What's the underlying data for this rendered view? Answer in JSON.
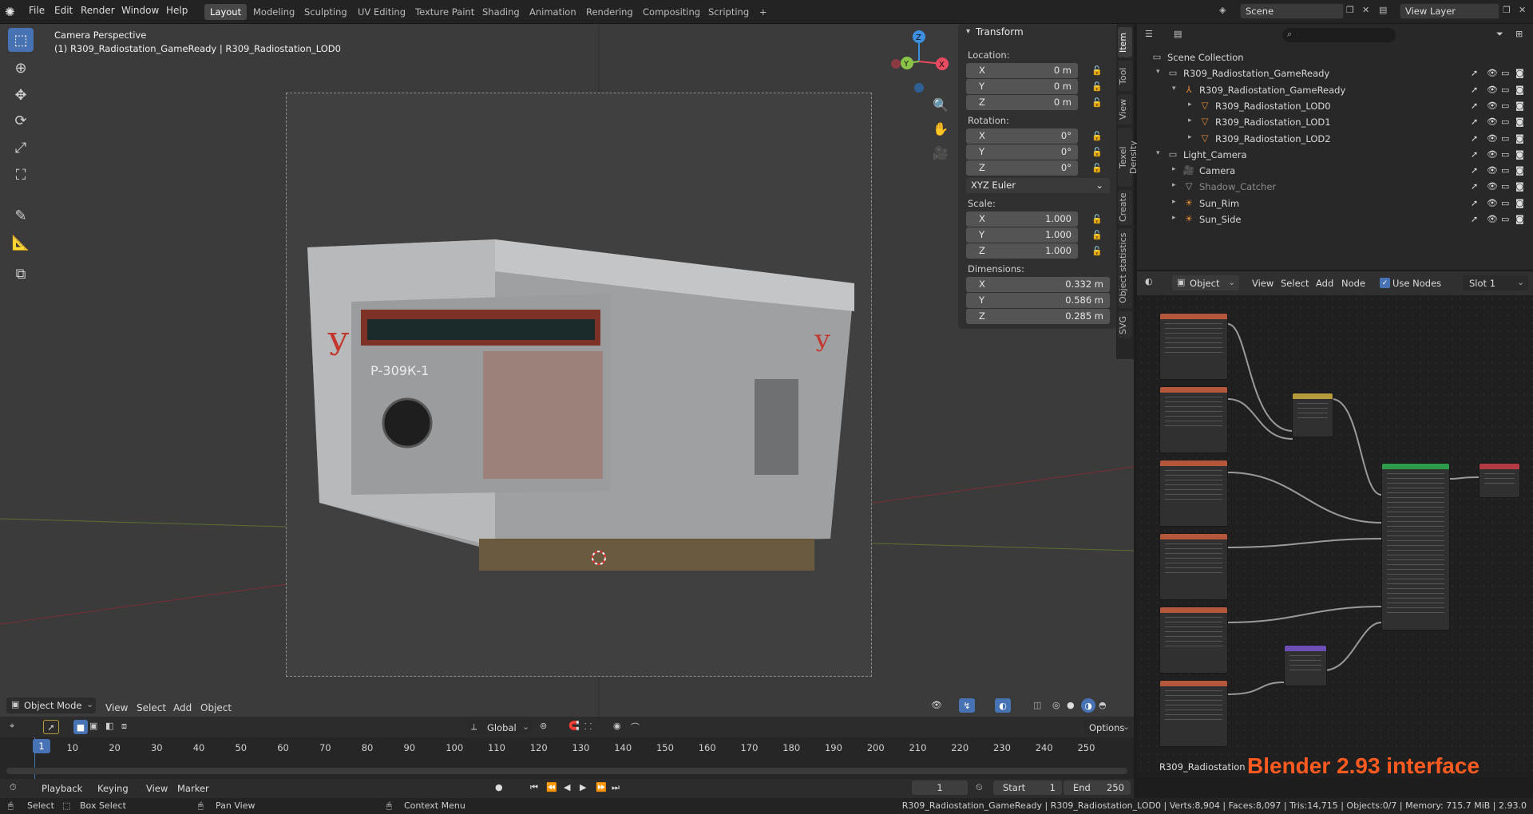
{
  "menu": {
    "items": [
      "File",
      "Edit",
      "Render",
      "Window",
      "Help"
    ]
  },
  "workspaces": {
    "tabs": [
      "Layout",
      "Modeling",
      "Sculpting",
      "UV Editing",
      "Texture Paint",
      "Shading",
      "Animation",
      "Rendering",
      "Compositing",
      "Scripting"
    ],
    "add": "+"
  },
  "scene": {
    "label": "Scene",
    "view_layer": "View Layer"
  },
  "viewport": {
    "title": "Camera Perspective",
    "subtitle": "(1) R309_Radiostation_GameReady | R309_Radiostation_LOD0",
    "mode": "Object Mode",
    "menu": [
      "View",
      "Select",
      "Add",
      "Object"
    ],
    "transform_orientation": "Global",
    "options": "Options",
    "gizmo": {
      "x": "X",
      "y": "Y",
      "z": "Z"
    }
  },
  "npanel": {
    "header": "Transform",
    "location_label": "Location:",
    "location": [
      {
        "axis": "X",
        "value": "0 m"
      },
      {
        "axis": "Y",
        "value": "0 m"
      },
      {
        "axis": "Z",
        "value": "0 m"
      }
    ],
    "rotation_label": "Rotation:",
    "rotation": [
      {
        "axis": "X",
        "value": "0°"
      },
      {
        "axis": "Y",
        "value": "0°"
      },
      {
        "axis": "Z",
        "value": "0°"
      }
    ],
    "rotation_mode": "XYZ Euler",
    "scale_label": "Scale:",
    "scale": [
      {
        "axis": "X",
        "value": "1.000"
      },
      {
        "axis": "Y",
        "value": "1.000"
      },
      {
        "axis": "Z",
        "value": "1.000"
      }
    ],
    "dimensions_label": "Dimensions:",
    "dimensions": [
      {
        "axis": "X",
        "value": "0.332 m"
      },
      {
        "axis": "Y",
        "value": "0.586 m"
      },
      {
        "axis": "Z",
        "value": "0.285 m"
      }
    ]
  },
  "sidetabs": [
    "Item",
    "Tool",
    "View",
    "Texel Density",
    "Create",
    "Object statistics",
    "SVG"
  ],
  "outliner": {
    "rows": [
      {
        "name": "Scene Collection",
        "icon": "collection-icon",
        "color": "#bdbdbd"
      },
      {
        "name": "R309_Radiostation_GameReady",
        "icon": "collection-icon",
        "color": "#bdbdbd"
      },
      {
        "name": "R309_Radiostation_GameReady",
        "icon": "empty-icon",
        "color": "#e08a3a"
      },
      {
        "name": "R309_Radiostation_LOD0",
        "icon": "mesh-icon",
        "color": "#e08a3a"
      },
      {
        "name": "R309_Radiostation_LOD1",
        "icon": "mesh-icon",
        "color": "#e08a3a"
      },
      {
        "name": "R309_Radiostation_LOD2",
        "icon": "mesh-icon",
        "color": "#e08a3a"
      },
      {
        "name": "Light_Camera",
        "icon": "collection-icon",
        "color": "#bdbdbd"
      },
      {
        "name": "Camera",
        "icon": "camera-icon",
        "color": "#e08a3a"
      },
      {
        "name": "Shadow_Catcher",
        "icon": "mesh-icon",
        "color": "#9a9a9a"
      },
      {
        "name": "Sun_Rim",
        "icon": "light-icon",
        "color": "#e08a3a"
      },
      {
        "name": "Sun_Side",
        "icon": "light-icon",
        "color": "#e08a3a"
      }
    ]
  },
  "shader": {
    "type": "Object",
    "menu": [
      "View",
      "Select",
      "Add",
      "Node"
    ],
    "use_nodes": "Use Nodes",
    "slot": "Slot 1",
    "material_name": "R309_Radiostation"
  },
  "timeline": {
    "menu": [
      "Playback",
      "Keying",
      "View",
      "Marker"
    ],
    "ticks": [
      "1",
      "10",
      "20",
      "30",
      "40",
      "50",
      "60",
      "70",
      "80",
      "90",
      "100",
      "110",
      "120",
      "130",
      "140",
      "150",
      "160",
      "170",
      "180",
      "190",
      "200",
      "210",
      "220",
      "230",
      "240",
      "250"
    ],
    "current_frame": "1",
    "start_label": "Start",
    "start": "1",
    "end_label": "End",
    "end": "250"
  },
  "watermark": "Blender 2.93 interface",
  "status": {
    "select": "Select",
    "box_select": "Box Select",
    "pan_view": "Pan View",
    "context_menu": "Context Menu",
    "stats": "R309_Radiostation_GameReady | R309_Radiostation_LOD0 | Verts:8,904 | Faces:8,097 | Tris:14,715 | Objects:0/7 | Memory: 715.7 MiB | 2.93.0"
  },
  "colors": {
    "accent": "#4772b3",
    "watermark": "#ff5a1f",
    "x_axis": "#e84a5f",
    "y_axis": "#8bc34a",
    "z_axis": "#3d8fe0"
  }
}
